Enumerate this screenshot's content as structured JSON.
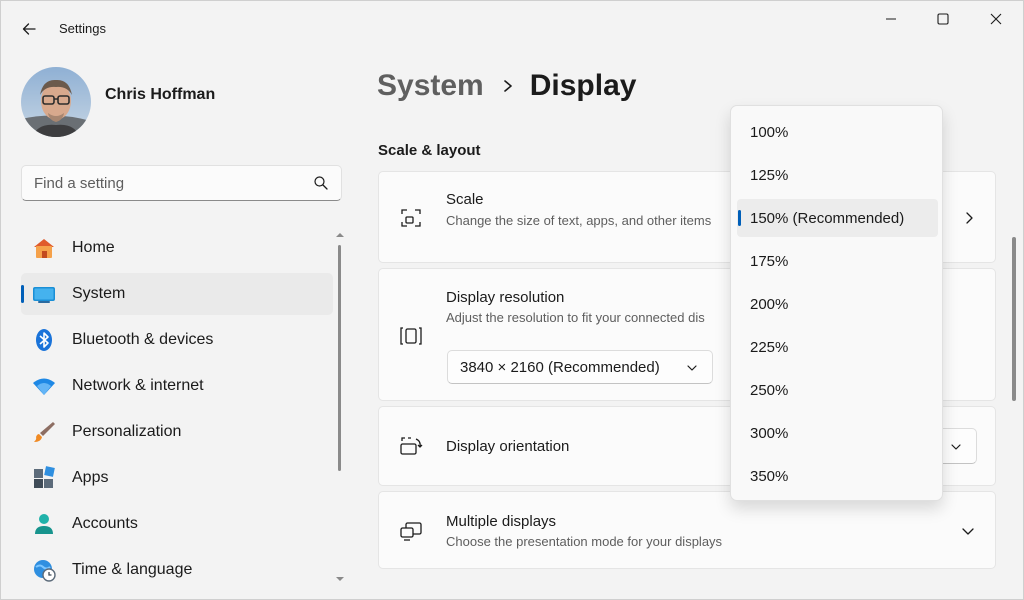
{
  "titlebar": {
    "title": "Settings"
  },
  "profile": {
    "name": "Chris Hoffman"
  },
  "search": {
    "placeholder": "Find a setting"
  },
  "nav": {
    "items": [
      {
        "label": "Home",
        "icon": "home-icon"
      },
      {
        "label": "System",
        "icon": "system-icon",
        "active": true
      },
      {
        "label": "Bluetooth & devices",
        "icon": "bluetooth-icon"
      },
      {
        "label": "Network & internet",
        "icon": "wifi-icon"
      },
      {
        "label": "Personalization",
        "icon": "brush-icon"
      },
      {
        "label": "Apps",
        "icon": "apps-icon"
      },
      {
        "label": "Accounts",
        "icon": "person-icon"
      },
      {
        "label": "Time & language",
        "icon": "globe-clock-icon"
      }
    ]
  },
  "breadcrumb": {
    "parent": "System",
    "current": "Display"
  },
  "section": {
    "title": "Scale & layout"
  },
  "cards": {
    "scale": {
      "title": "Scale",
      "subtitle": "Change the size of text, apps, and other items",
      "icon": "scale-icon"
    },
    "resolution": {
      "title": "Display resolution",
      "subtitle": "Adjust the resolution to fit your connected dis",
      "value": "3840 × 2160 (Recommended)",
      "icon": "resolution-icon"
    },
    "orientation": {
      "title": "Display orientation",
      "icon": "orientation-icon"
    },
    "multiple": {
      "title": "Multiple displays",
      "subtitle": "Choose the presentation mode for your displays",
      "icon": "multiple-displays-icon"
    }
  },
  "scale_dropdown": {
    "options": [
      "100%",
      "125%",
      "150% (Recommended)",
      "175%",
      "200%",
      "225%",
      "250%",
      "300%",
      "350%"
    ],
    "selected": "150% (Recommended)"
  },
  "colors": {
    "accent": "#005fb8",
    "window_bg": "#f3f3f3",
    "card_bg": "#fbfbfb"
  }
}
